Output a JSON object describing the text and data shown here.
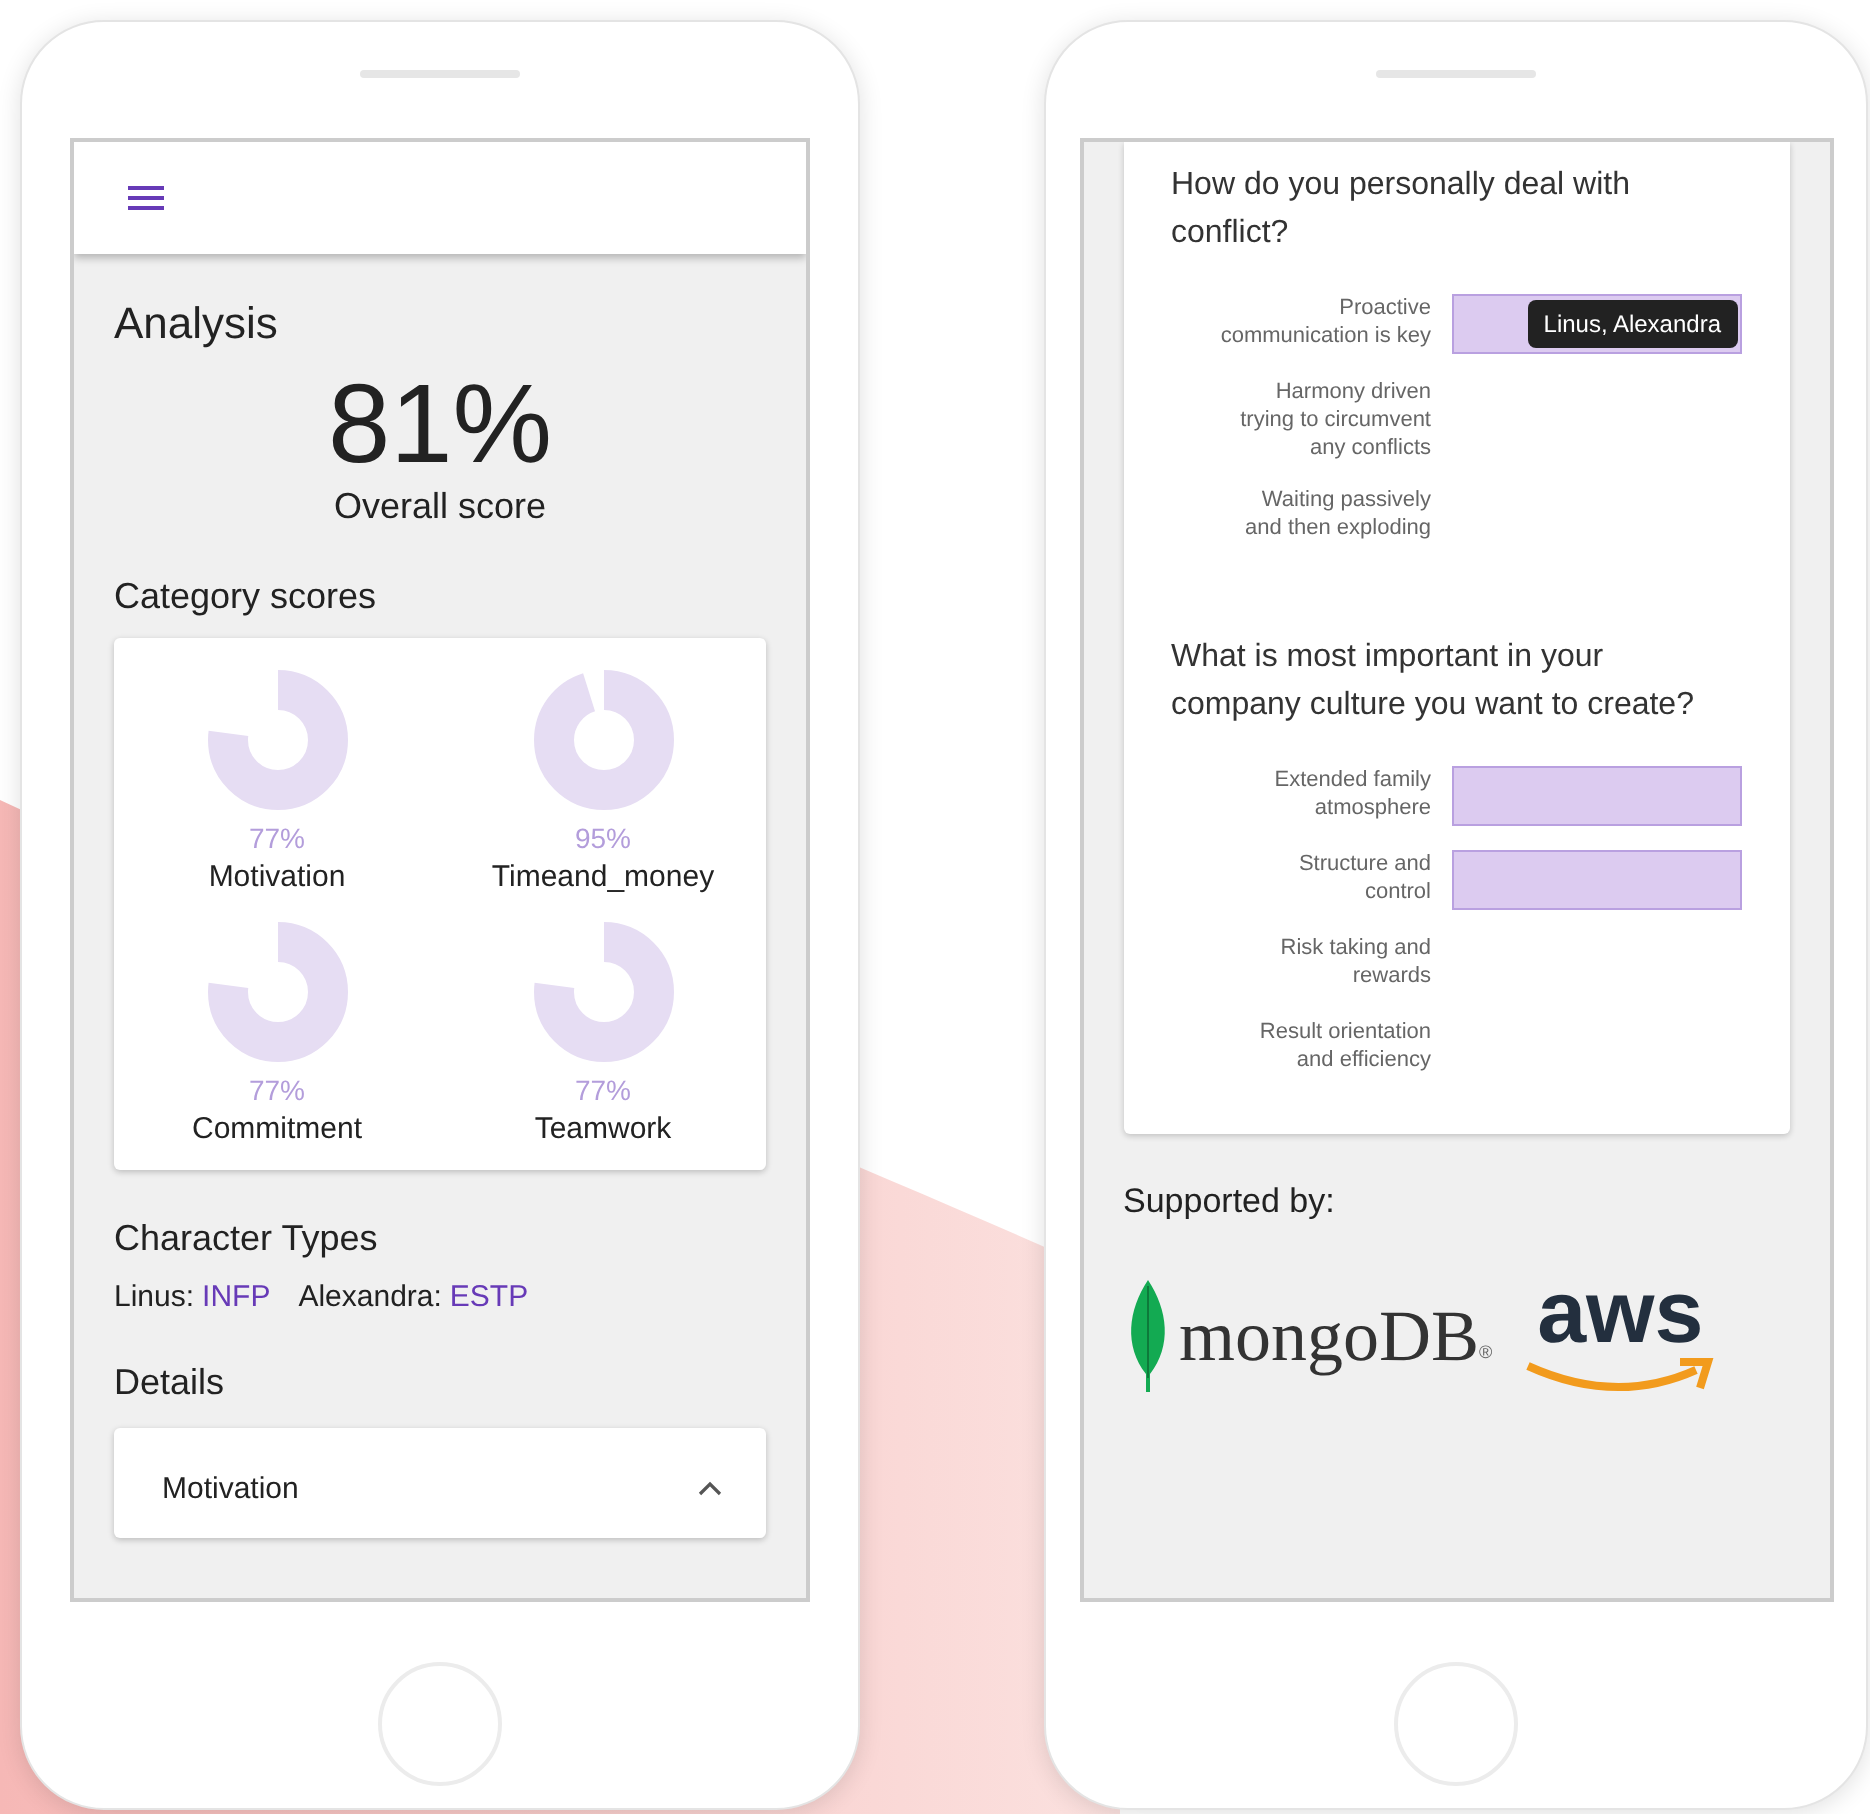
{
  "analysis_screen": {
    "title": "Analysis",
    "score": "81%",
    "score_label": "Overall score",
    "category_heading": "Category scores",
    "categories": [
      {
        "name": "Motivation",
        "percent": "77%",
        "level": 0.77
      },
      {
        "name": "Timeand_money",
        "percent": "95%",
        "level": 0.95
      },
      {
        "name": "Commitment",
        "percent": "77%",
        "level": 0.77
      },
      {
        "name": "Teamwork",
        "percent": "77%",
        "level": 0.77
      }
    ],
    "character_heading": "Character Types",
    "character_types": [
      {
        "name": "Linus:",
        "type": "INFP"
      },
      {
        "name": "Alexandra:",
        "type": "ESTP"
      }
    ],
    "details_heading": "Details",
    "details": [
      {
        "label": "Motivation",
        "expanded": true
      }
    ]
  },
  "survey_screen": {
    "questions": [
      {
        "question": "How do you personally deal with conflict?",
        "answers": [
          {
            "label": "Proactive\ncommunication is key",
            "selected": true,
            "tooltip": "Linus, Alexandra"
          },
          {
            "label": "Harmony driven\ntrying to circumvent\nany conflicts",
            "selected": false
          },
          {
            "label": "Waiting passively\nand then exploding",
            "selected": false
          }
        ]
      },
      {
        "question": "What is most important in your company culture you want to create?",
        "answers": [
          {
            "label": "Extended family\natmosphere",
            "selected": true
          },
          {
            "label": "Structure and\ncontrol",
            "selected": true
          },
          {
            "label": "Risk taking and\nrewards",
            "selected": false
          },
          {
            "label": "Result orientation\nand efficiency",
            "selected": false
          }
        ]
      }
    ],
    "supported_by": "Supported by:",
    "sponsors": [
      {
        "kind": "mongodb",
        "name": "mongoDB",
        "mark": "®"
      },
      {
        "kind": "aws",
        "name": "aws"
      }
    ]
  }
}
